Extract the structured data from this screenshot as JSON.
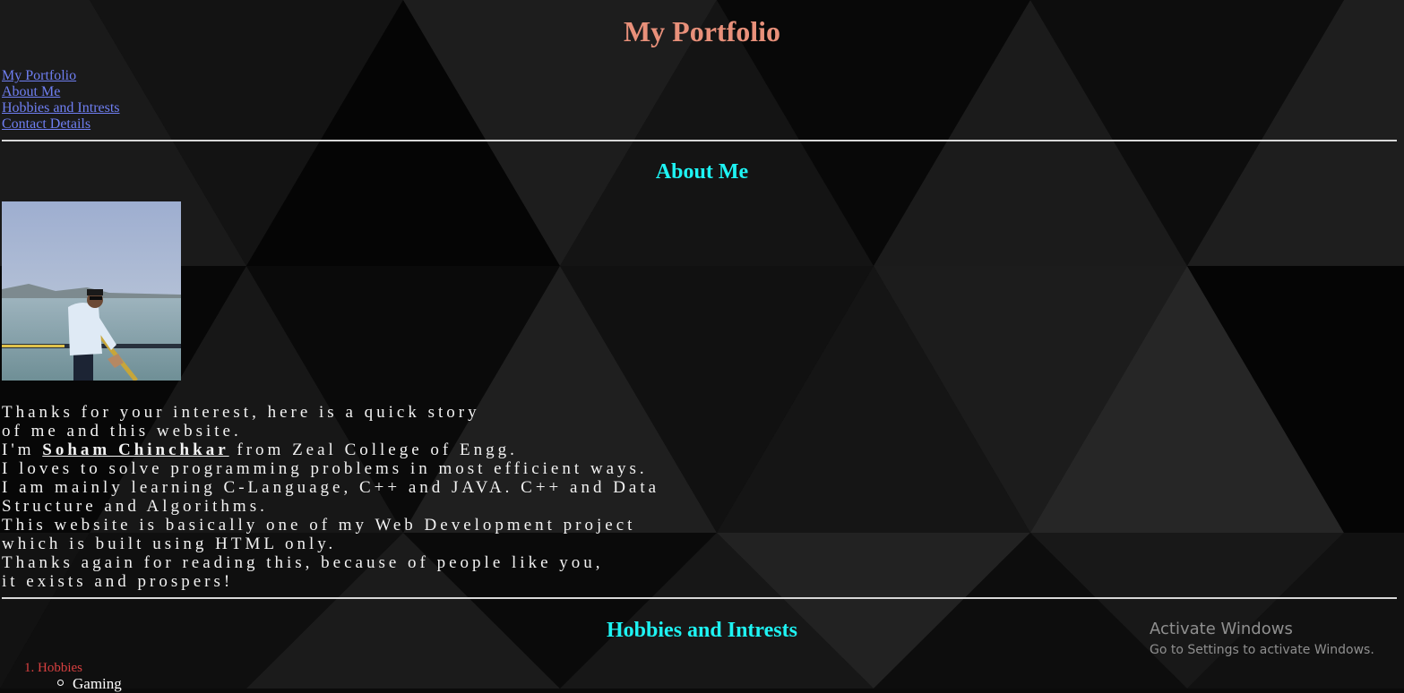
{
  "header": {
    "title": "My Portfolio"
  },
  "nav": {
    "links": [
      "My Portfolio",
      "About Me",
      "Hobbies and Intrests",
      "Contact Details"
    ]
  },
  "about": {
    "heading": "About Me",
    "photo_alt": "",
    "bio": {
      "line1": "Thanks for your interest, here is a quick story",
      "line2": "of me and this website.",
      "line3_prefix": "I'm ",
      "name": "Soham Chinchkar",
      "line3_suffix": " from Zeal College of Engg.",
      "line4": "I loves to solve programming problems in most efficient ways.",
      "line5": "I am mainly learning C-Language, C++ and JAVA. C++ and Data",
      "line6": "Structure and Algorithms.",
      "line7": "This website is basically one of my Web Development project",
      "line8": "which is built using HTML only.",
      "line9": "Thanks again for reading this, because of people like you,",
      "line10": "it exists and prospers!"
    }
  },
  "hobbies": {
    "heading": "Hobbies and Intrests",
    "list": [
      {
        "number": "1.",
        "label": "Hobbies",
        "items": [
          "Gaming"
        ]
      }
    ]
  },
  "watermark": {
    "title": "Activate Windows",
    "subtitle": "Go to Settings to activate Windows."
  },
  "colors": {
    "title": "#e8907a",
    "heading": "#1ef3f3",
    "link": "#6f7ff2",
    "list_marker": "#d84040",
    "text": "#f2f2f2"
  }
}
